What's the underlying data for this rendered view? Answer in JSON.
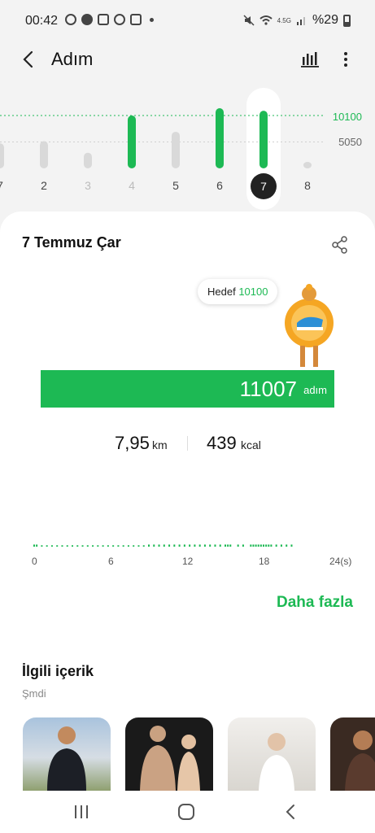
{
  "status_bar": {
    "time": "00:42",
    "network": "4.5G",
    "battery": "%29",
    "icons": [
      "upload-icon",
      "account-icon",
      "package-icon",
      "podcast-icon",
      "instagram-icon",
      "dot-icon",
      "mute-icon",
      "wifi-icon",
      "signal-icon",
      "battery-icon"
    ]
  },
  "header": {
    "title": "Adım",
    "actions": [
      "bar-chart-icon",
      "more-icon"
    ]
  },
  "daily_chart": {
    "goal_label": "10100",
    "mid_label": "5050",
    "days": [
      "7",
      "2",
      "3",
      "4",
      "5",
      "6",
      "7",
      "8"
    ],
    "selected_day": "7"
  },
  "chart_data": [
    {
      "type": "bar",
      "categories": [
        "7",
        "2",
        "3",
        "4",
        "5",
        "6",
        "7",
        "8"
      ],
      "values": [
        4800,
        5200,
        3000,
        10100,
        7000,
        11500,
        11007,
        500
      ],
      "goal": 10100,
      "ylim": [
        0,
        12000
      ]
    },
    {
      "type": "bar",
      "x_tick_labels": [
        "0",
        "6",
        "12",
        "18",
        "24(s)"
      ],
      "x_unit": "s",
      "xlim": [
        0,
        24
      ],
      "x": [
        0.0,
        0.2,
        0.6,
        1.0,
        1.4,
        1.8,
        2.2,
        2.6,
        3.0,
        3.4,
        3.8,
        4.2,
        4.6,
        5.0,
        5.4,
        5.8,
        6.2,
        6.6,
        7.0,
        7.4,
        7.8,
        8.2,
        8.6,
        9.0,
        9.4,
        9.8,
        10.2,
        10.6,
        11.0,
        11.4,
        11.8,
        12.2,
        12.6,
        13.0,
        13.4,
        13.8,
        14.2,
        14.6,
        15.0,
        15.2,
        15.4,
        16.0,
        16.4,
        17.0,
        17.2,
        17.4,
        17.6,
        17.8,
        18.0,
        18.2,
        18.4,
        18.6,
        19.0,
        19.4,
        19.8,
        20.2
      ],
      "values": [
        3,
        3,
        2,
        2,
        2,
        2,
        2,
        2,
        2,
        2,
        2,
        2,
        2,
        2,
        2,
        2,
        2,
        2,
        2,
        2,
        2,
        2,
        2,
        3,
        3,
        3,
        3,
        3,
        3,
        3,
        3,
        3,
        3,
        3,
        3,
        3,
        3,
        3,
        3,
        3,
        3,
        3,
        3,
        3,
        3,
        3,
        3,
        3,
        3,
        3,
        3,
        3,
        3,
        3,
        3,
        3
      ],
      "ylim": [
        0,
        100
      ]
    }
  ],
  "card": {
    "date": "7 Temmuz Çar",
    "goal_prefix": "Hedef",
    "goal_value": "10100",
    "steps": "11007",
    "steps_unit": "adım",
    "distance_value": "7,95",
    "distance_unit": "km",
    "calories_value": "439",
    "calories_unit": "kcal",
    "more_label": "Daha fazla",
    "related_title": "İlgili içerik",
    "related_sub": "Şmdi"
  },
  "colors": {
    "accent": "#1db954",
    "bar_gray": "#d9d9d9",
    "selected_bg": "#222222"
  },
  "nav": [
    "recent-apps-icon",
    "home-icon",
    "back-icon"
  ]
}
